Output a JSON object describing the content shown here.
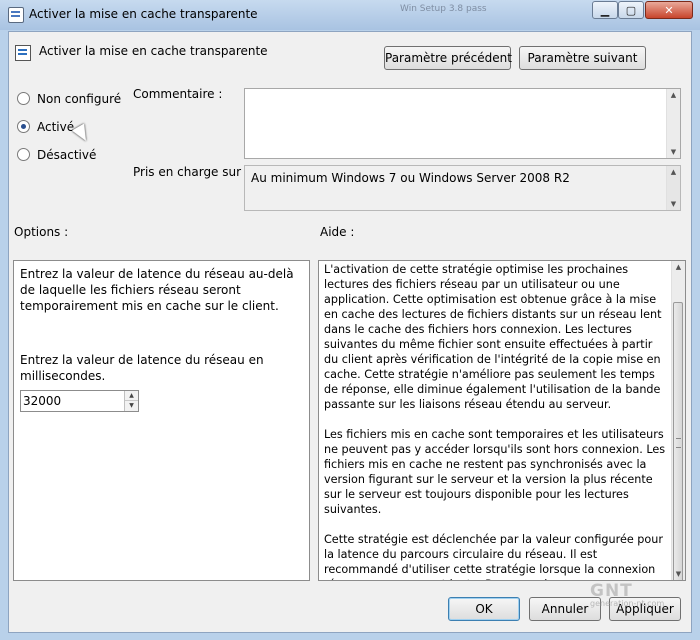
{
  "window": {
    "title": "Activer la mise en cache transparente",
    "background_title": "Win Setup 3.8 pass",
    "minimize_label": "▁",
    "maximize_label": "▢",
    "close_label": "✕"
  },
  "header": {
    "policy_title": "Activer la mise en cache transparente",
    "previous_button": "Paramètre précédent",
    "next_button": "Paramètre suivant"
  },
  "state": {
    "options": [
      {
        "label": "Non configuré",
        "selected": false
      },
      {
        "label": "Activé",
        "selected": true
      },
      {
        "label": "Désactivé",
        "selected": false
      }
    ]
  },
  "comment": {
    "label": "Commentaire :",
    "value": ""
  },
  "supported": {
    "label": "Pris en charge sur :",
    "value": "Au minimum Windows 7 ou Windows Server 2008 R2"
  },
  "options_panel": {
    "label": "Options :",
    "description": "Entrez la valeur de latence du réseau au-delà de laquelle les fichiers réseau seront temporairement mis en cache sur le client.",
    "input_label": "Entrez la valeur de latence du réseau en millisecondes.",
    "latency_value": "32000"
  },
  "help_panel": {
    "label": "Aide :",
    "paragraphs": [
      "L'activation de cette stratégie optimise les prochaines lectures des fichiers réseau par un utilisateur ou une application. Cette optimisation est obtenue grâce à la mise en cache des lectures de fichiers distants sur un réseau lent dans le cache des fichiers hors connexion. Les lectures suivantes du même fichier sont ensuite effectuées à partir du client après vérification de l'intégrité de la copie mise en cache. Cette stratégie n'améliore pas seulement les temps de réponse, elle diminue également l'utilisation de la bande passante sur les liaisons réseau étendu au serveur.",
      "Les fichiers mis en cache sont temporaires et les utilisateurs ne peuvent pas y accéder lorsqu'ils sont hors connexion. Les fichiers mis en cache ne restent pas synchronisés avec la version figurant sur le serveur et la version la plus récente sur le serveur est toujours disponible pour les lectures suivantes.",
      "Cette stratégie est déclenchée par la valeur configurée pour la latence du parcours circulaire du réseau. Il est recommandé d'utiliser cette stratégie lorsque la connexion réseau au serveur est lente. Par exemple, vous pouvez configurer une valeur de"
    ]
  },
  "footer": {
    "ok_button": "OK",
    "cancel_button": "Annuler",
    "apply_button": "Appliquer"
  },
  "watermark": {
    "brand": "GNT",
    "site": "generation-nt.com"
  }
}
